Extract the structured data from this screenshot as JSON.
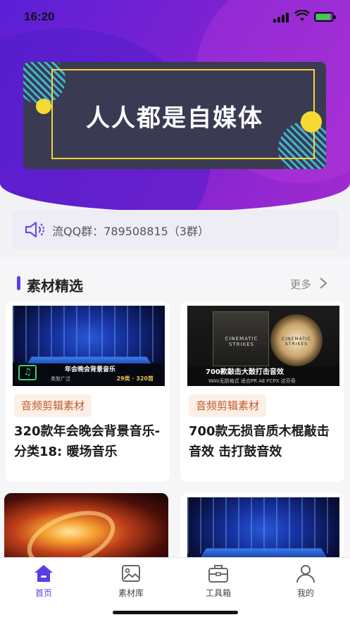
{
  "status_bar": {
    "time": "16:20"
  },
  "banner": {
    "title": "人人都是自媒体"
  },
  "notice": {
    "text": "流QQ群：789508815（3群）"
  },
  "section": {
    "title": "素材精选",
    "more_label": "更多"
  },
  "cards": [
    {
      "tag": "音频剪辑素材",
      "title": "320款年会晚会背景音乐-分类18: 暖场音乐",
      "image": {
        "caption": "年会晚会背景音乐",
        "subcaption": "类型广泛",
        "meta": "29类 · 320首"
      }
    },
    {
      "tag": "音频剪辑素材",
      "title": "700款无损音质木棍敲击音效 击打鼓音效",
      "image": {
        "caption": "700款敲击大鼓打击音效",
        "subcaption": "WAV无损格式 适合PR AE FCPX 达芬奇",
        "box_text": "CINEMATIC STRIKES",
        "circle_text": "CINEMATIC STRIKES"
      }
    }
  ],
  "tabs": [
    {
      "label": "首页",
      "icon": "home-icon",
      "active": true
    },
    {
      "label": "素材库",
      "icon": "image-library-icon",
      "active": false
    },
    {
      "label": "工具箱",
      "icon": "toolbox-icon",
      "active": false
    },
    {
      "label": "我的",
      "icon": "user-icon",
      "active": false
    }
  ],
  "colors": {
    "accent": "#5b3ce6",
    "tag_bg": "#fcefe6",
    "tag_text": "#c15a2a",
    "banner_bg": "#3a3b52",
    "banner_yellow": "#f6d933"
  }
}
